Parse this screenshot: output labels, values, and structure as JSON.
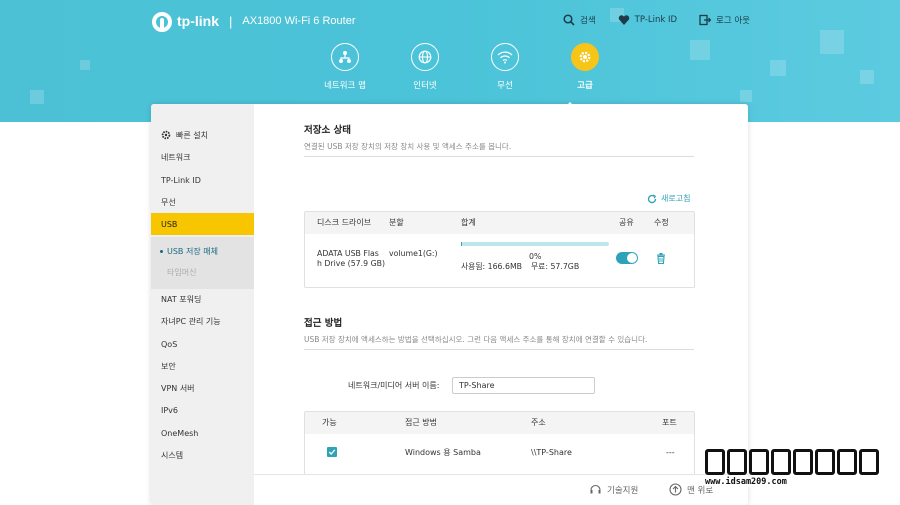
{
  "brand": {
    "logo": "tp-link",
    "separator": "|",
    "model": "AX1800 Wi-Fi 6 Router"
  },
  "top_actions": [
    {
      "label": "검색",
      "icon": "search-icon"
    },
    {
      "label": "TP-Link ID",
      "icon": "heart-icon"
    },
    {
      "label": "로그 아웃",
      "icon": "logout-icon"
    }
  ],
  "nav": [
    {
      "label": "네트워크 맵",
      "icon": "network-map-icon"
    },
    {
      "label": "인터넷",
      "icon": "globe-icon"
    },
    {
      "label": "무선",
      "icon": "wifi-icon"
    },
    {
      "label": "고급",
      "icon": "gear-icon",
      "active": true
    }
  ],
  "sidebar": {
    "quick_setup": "빠른 설치",
    "items": [
      "네트워크",
      "TP-Link ID",
      "무선",
      "USB"
    ],
    "sub_items": [
      "USB 저장 매체",
      "타임머신"
    ],
    "items_after": [
      "NAT 포워딩",
      "자녀PC 관리 기능",
      "QoS",
      "보안",
      "VPN 서버",
      "IPv6",
      "OneMesh",
      "시스템"
    ]
  },
  "storage": {
    "title": "저장소 상태",
    "desc": "연결된 USB 저장 장치의 저장 장치 사용 및 액세스 주소를 봅니다.",
    "refresh": "새로고침",
    "headers": [
      "디스크 드라이브",
      "분할",
      "합계",
      "공유",
      "수정"
    ],
    "row": {
      "drive_line1": "ADATA   USB Flas",
      "drive_line2": "h Drive (57.9 GB)",
      "partition": "volume1(G:)",
      "percent": "0%",
      "used": "사용됨: 166.6MB",
      "free": "무료: 57.7GB",
      "usage_fraction": 0.003,
      "share_enabled": true
    }
  },
  "access": {
    "title": "접근 방법",
    "desc": "USB 저장 장치에 액세스하는 방법을 선택하십시오. 그런 다음 액세스 주소를 통해 장치에 연결할 수 있습니다.",
    "server_label": "네트워크/미디어 서버 이름:",
    "server_value": "TP-Share",
    "headers": [
      "가능",
      "접근 방법",
      "주소",
      "포트"
    ],
    "row": {
      "enabled": true,
      "method": "Windows 용 Samba",
      "address": "\\\\TP-Share",
      "port": "---"
    }
  },
  "footer": {
    "support": "기술지원",
    "top": "맨 위로"
  },
  "watermark": {
    "url": "www.idsam209.com"
  },
  "colors": {
    "header": "#4cc1d6",
    "accent": "#f6c518",
    "teal": "#2ea3b8",
    "active_side": "#f7c600"
  }
}
